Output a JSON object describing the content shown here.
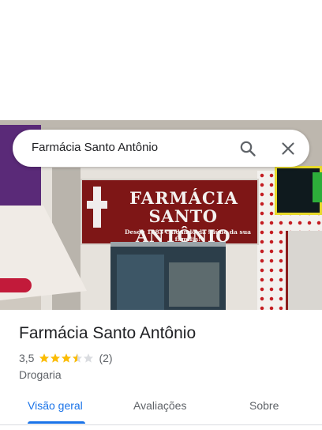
{
  "search": {
    "query": "Farmácia Santo Antônio",
    "search_icon": "search-icon",
    "close_icon": "close-icon"
  },
  "photo": {
    "sign_line1": "FARMÁCIA",
    "sign_line2": "SANTO ANTÔNIO",
    "sign_line3": "Desde 1983 cuidando da saúde da sua família!"
  },
  "place": {
    "title": "Farmácia Santo Antônio",
    "rating": "3,5",
    "rating_stars": 3.5,
    "review_count": "(2)",
    "category": "Drogaria"
  },
  "tabs": [
    {
      "label": "Visão geral",
      "active": true
    },
    {
      "label": "Avaliações",
      "active": false
    },
    {
      "label": "Sobre",
      "active": false
    }
  ],
  "colors": {
    "accent": "#1a73e8",
    "star": "#fbbc04",
    "star_empty": "#dadce0",
    "text_primary": "#202124",
    "text_secondary": "#5f6368"
  }
}
